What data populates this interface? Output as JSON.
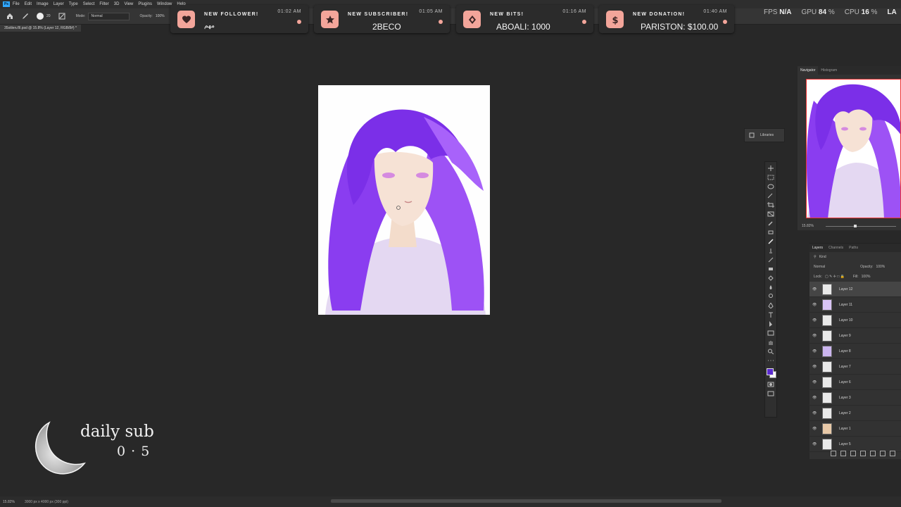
{
  "menubar": {
    "app_icon": "Ps",
    "items": [
      "File",
      "Edit",
      "Image",
      "Layer",
      "Type",
      "Select",
      "Filter",
      "3D",
      "View",
      "Plugins",
      "Window",
      "Help"
    ]
  },
  "options_bar": {
    "brush_size": "20",
    "mode_label": "Mode:",
    "mode_value": "Normal",
    "opacity_label": "Opacity:",
    "opacity_value": "100%"
  },
  "document_tab": "35stileru’lll.psd @ 15.8% (Layer 12, RGB/8#) *",
  "notifications": [
    {
      "title": "NEW FOLLOWER!",
      "time": "01:02 AM",
      "name": "مهم",
      "icon": "heart-icon",
      "accent": "#f3a59a"
    },
    {
      "title": "NEW SUBSCRIBER!",
      "time": "01:05 AM",
      "name": "2BECO",
      "icon": "star-icon",
      "accent": "#f3a59a"
    },
    {
      "title": "NEW BITS!",
      "time": "01:16 AM",
      "name": "ABOALI: 1000",
      "icon": "bits-diamond-icon",
      "accent": "#f3a59a"
    },
    {
      "title": "NEW DONATION!",
      "time": "01:40 AM",
      "name": "PARISTON: $100.00",
      "icon": "dollar-icon",
      "accent": "#f3a59a"
    }
  ],
  "perf": {
    "fps_label": "FPS",
    "fps_value": "N/A",
    "gpu_label": "GPU",
    "gpu_value": "84",
    "cpu_label": "CPU",
    "cpu_value": "16",
    "percent": "%",
    "extra": "LA"
  },
  "libraries": {
    "label": "Libraries"
  },
  "navigator": {
    "tabs": [
      "Navigator",
      "Histogram"
    ],
    "zoom": "15.82%"
  },
  "layers_panel": {
    "tabs": [
      "Layers",
      "Channels",
      "Paths"
    ],
    "filter_kind": "Kind",
    "blend_mode": "Normal",
    "opacity_label": "Opacity:",
    "opacity_value": "100%",
    "lock_label": "Lock:",
    "fill_label": "Fill:",
    "fill_value": "100%",
    "layers": [
      "Layer 12",
      "Layer 11",
      "Layer 10",
      "Layer 9",
      "Layer 8",
      "Layer 7",
      "Layer 6",
      "Layer 3",
      "Layer 2",
      "Layer 1",
      "Layer 5"
    ]
  },
  "daily_sub": {
    "title": "daily sub",
    "count": "0 · 5"
  },
  "status_bar": {
    "zoom": "15.82%",
    "doc_info": "3000 px x 4000 px (300 ppi)"
  },
  "colors": {
    "foreground": "#5b2bd0",
    "background": "#ffffff",
    "hair": "#8a3df0",
    "accent": "#f3a59a"
  }
}
